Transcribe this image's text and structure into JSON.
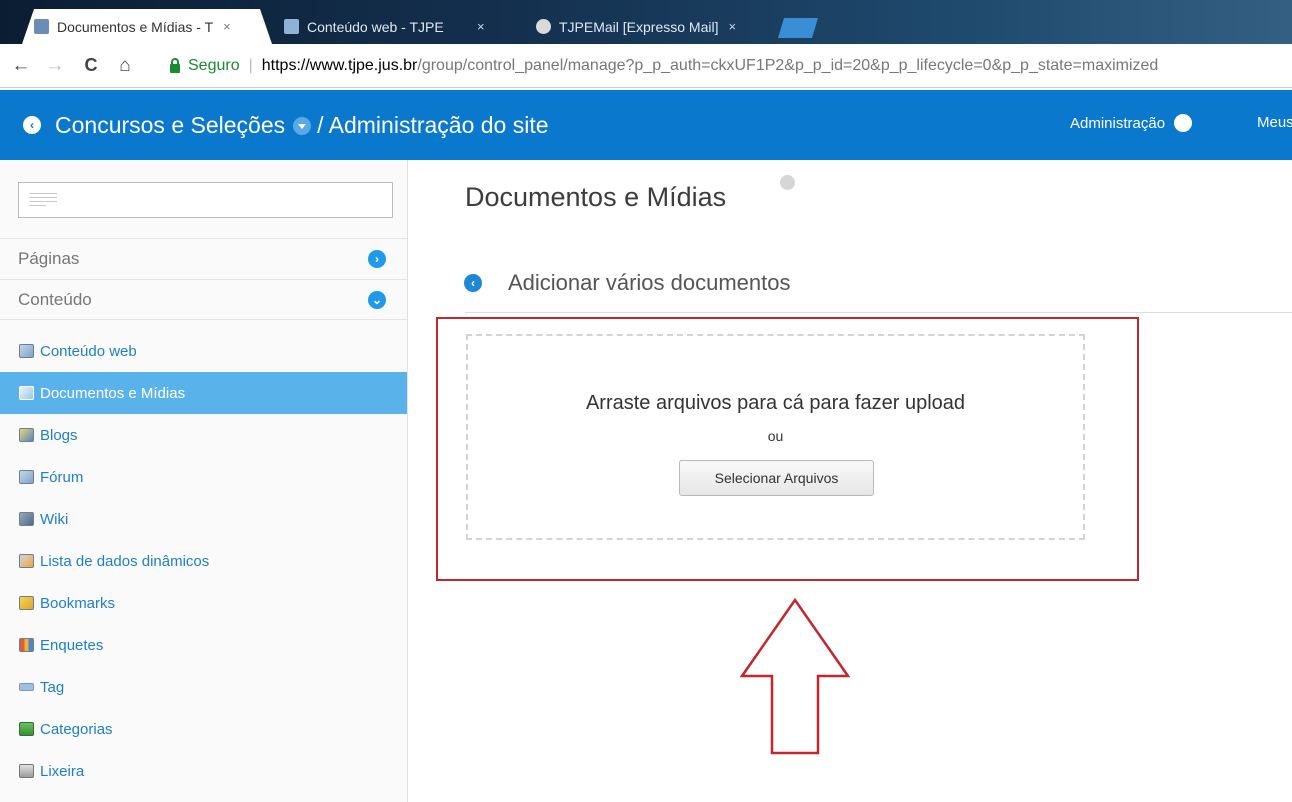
{
  "browser": {
    "tabs": [
      {
        "title": "Documentos e Mídias - T",
        "close": "×"
      },
      {
        "title": "Conteúdo web - TJPE",
        "close": "×"
      },
      {
        "title": "TJPEMail [Expresso Mail]",
        "close": "×"
      }
    ],
    "nav": {
      "back": "←",
      "forward": "→",
      "reload": "C",
      "home": "⌂"
    },
    "security_label": "Seguro",
    "url_host": "https://www.tjpe.jus.br",
    "url_path": "/group/control_panel/manage?p_p_auth=ckxUF1P2&p_p_id=20&p_p_lifecycle=0&p_p_state=maximized"
  },
  "header": {
    "back_glyph": "‹",
    "site_name": "Concursos e Seleções",
    "separator": "/",
    "section": "Administração do site",
    "admin_menu": "Administração",
    "my_menu": "Meus"
  },
  "sidebar": {
    "sections": [
      {
        "label": "Páginas",
        "toggle": "›"
      },
      {
        "label": "Conteúdo",
        "toggle": "⌄"
      }
    ],
    "items": [
      {
        "label": "Conteúdo web",
        "icon": "web-content-icon"
      },
      {
        "label": "Documentos e Mídias",
        "icon": "documents-icon",
        "active": true
      },
      {
        "label": "Blogs",
        "icon": "blogs-icon"
      },
      {
        "label": "Fórum",
        "icon": "forum-icon"
      },
      {
        "label": "Wiki",
        "icon": "wiki-icon"
      },
      {
        "label": "Lista de dados dinâmicos",
        "icon": "dynamic-data-list-icon"
      },
      {
        "label": "Bookmarks",
        "icon": "bookmarks-icon"
      },
      {
        "label": "Enquetes",
        "icon": "polls-icon"
      },
      {
        "label": "Tag",
        "icon": "tag-icon"
      },
      {
        "label": "Categorias",
        "icon": "categories-icon"
      },
      {
        "label": "Lixeira",
        "icon": "trash-icon"
      }
    ]
  },
  "main": {
    "title": "Documentos e Mídias",
    "back_glyph": "‹",
    "subtitle": "Adicionar vários documentos",
    "dropzone": {
      "instruction": "Arraste arquivos para cá para fazer upload",
      "or": "ou",
      "button": "Selecionar Arquivos"
    }
  },
  "colors": {
    "header_blue": "#0a78cc",
    "active_item": "#5ab2ea",
    "link_blue": "#1e7fc8",
    "annotation_red": "#c1272d"
  }
}
